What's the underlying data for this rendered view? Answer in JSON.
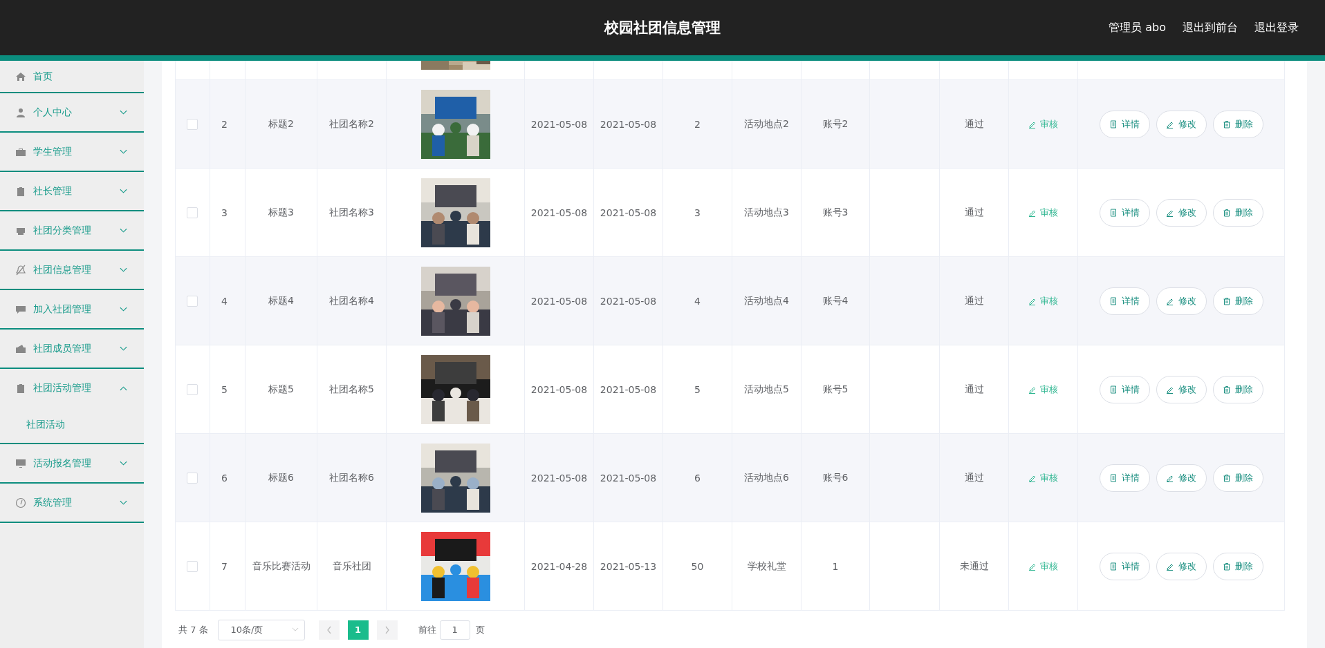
{
  "header": {
    "title": "校园社团信息管理",
    "links": [
      "管理员 abo",
      "退出到前台",
      "退出登录"
    ]
  },
  "sidebar": {
    "items": [
      {
        "label": "首页",
        "kind": "link"
      },
      {
        "label": "个人中心",
        "kind": "menu",
        "expanded": false
      },
      {
        "label": "学生管理",
        "kind": "menu",
        "expanded": false
      },
      {
        "label": "社长管理",
        "kind": "menu",
        "expanded": false
      },
      {
        "label": "社团分类管理",
        "kind": "menu",
        "expanded": false
      },
      {
        "label": "社团信息管理",
        "kind": "menu",
        "expanded": false
      },
      {
        "label": "加入社团管理",
        "kind": "menu",
        "expanded": false
      },
      {
        "label": "社团成员管理",
        "kind": "menu",
        "expanded": false
      },
      {
        "label": "社团活动管理",
        "kind": "menu",
        "expanded": true,
        "children": [
          {
            "label": "社团活动"
          }
        ]
      },
      {
        "label": "活动报名管理",
        "kind": "menu",
        "expanded": false
      },
      {
        "label": "系统管理",
        "kind": "menu",
        "expanded": false
      }
    ]
  },
  "table": {
    "rows": [
      {
        "checked": false,
        "index": "2",
        "title": "标题2",
        "club": "社团名称2",
        "start": "2021-05-08",
        "end": "2021-05-08",
        "count": "2",
        "place": "活动地点2",
        "account": "账号2",
        "status": "通过",
        "review": "审核",
        "actions": [
          "详情",
          "修改",
          "删除"
        ]
      },
      {
        "checked": false,
        "index": "3",
        "title": "标题3",
        "club": "社团名称3",
        "start": "2021-05-08",
        "end": "2021-05-08",
        "count": "3",
        "place": "活动地点3",
        "account": "账号3",
        "status": "通过",
        "review": "审核",
        "actions": [
          "详情",
          "修改",
          "删除"
        ]
      },
      {
        "checked": false,
        "index": "4",
        "title": "标题4",
        "club": "社团名称4",
        "start": "2021-05-08",
        "end": "2021-05-08",
        "count": "4",
        "place": "活动地点4",
        "account": "账号4",
        "status": "通过",
        "review": "审核",
        "actions": [
          "详情",
          "修改",
          "删除"
        ]
      },
      {
        "checked": false,
        "index": "5",
        "title": "标题5",
        "club": "社团名称5",
        "start": "2021-05-08",
        "end": "2021-05-08",
        "count": "5",
        "place": "活动地点5",
        "account": "账号5",
        "status": "通过",
        "review": "审核",
        "actions": [
          "详情",
          "修改",
          "删除"
        ]
      },
      {
        "checked": false,
        "index": "6",
        "title": "标题6",
        "club": "社团名称6",
        "start": "2021-05-08",
        "end": "2021-05-08",
        "count": "6",
        "place": "活动地点6",
        "account": "账号6",
        "status": "通过",
        "review": "审核",
        "actions": [
          "详情",
          "修改",
          "删除"
        ]
      },
      {
        "checked": false,
        "index": "7",
        "title": "音乐比赛活动",
        "club": "音乐社团",
        "start": "2021-04-28",
        "end": "2021-05-13",
        "count": "50",
        "place": "学校礼堂",
        "account": "1",
        "status": "未通过",
        "review": "审核",
        "actions": [
          "详情",
          "修改",
          "删除"
        ]
      }
    ]
  },
  "pagination": {
    "total": "共 7 条",
    "page_size": "10条/页",
    "pages": [
      {
        "label": "1",
        "selected": true
      }
    ],
    "goto_label": "前往",
    "goto_value": "1",
    "suffix": "页"
  }
}
